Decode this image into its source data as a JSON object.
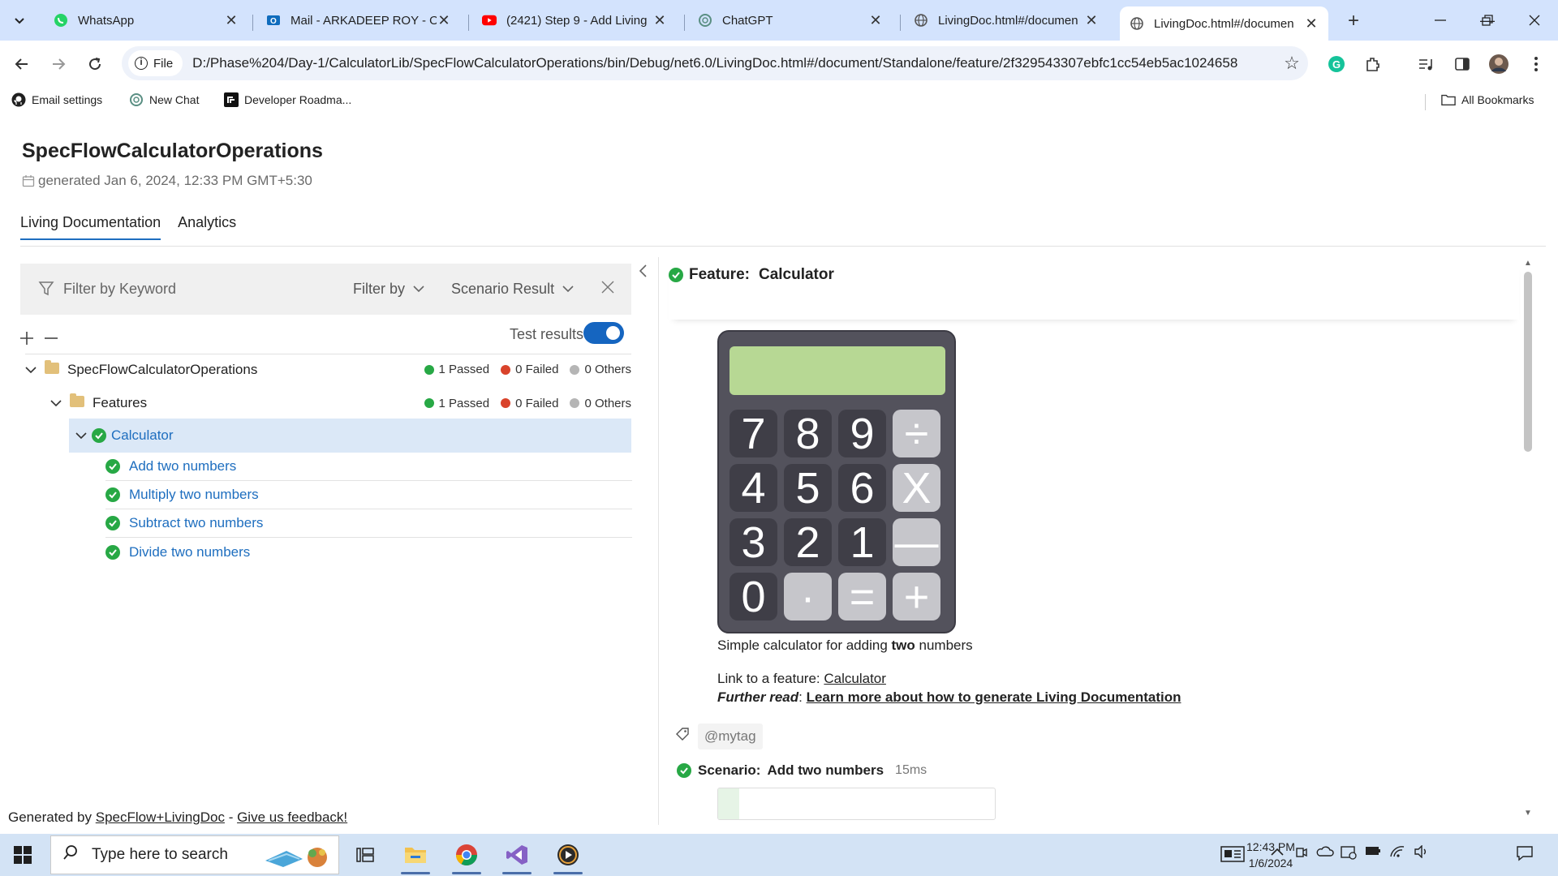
{
  "browser": {
    "tabs": [
      {
        "title": "WhatsApp",
        "icon": "whatsapp-icon"
      },
      {
        "title": "Mail - ARKADEEP ROY - Ou",
        "icon": "outlook-icon"
      },
      {
        "title": "(2421) Step 9 - Add Living",
        "icon": "youtube-icon"
      },
      {
        "title": "ChatGPT",
        "icon": "chatgpt-icon"
      },
      {
        "title": "LivingDoc.html#/documen",
        "icon": "globe-icon"
      },
      {
        "title": "LivingDoc.html#/documen",
        "icon": "globe-icon",
        "active": true
      }
    ],
    "address": {
      "scheme_label": "File",
      "url": "D:/Phase%204/Day-1/CalculatorLib/SpecFlowCalculatorOperations/bin/Debug/net6.0/LivingDoc.html#/document/Standalone/feature/2f329543307ebfc1cc54eb5ac1024658"
    },
    "bookmarks": [
      {
        "label": "Email settings",
        "icon": "github-icon"
      },
      {
        "label": "New Chat",
        "icon": "chatgpt-icon"
      },
      {
        "label": "Developer Roadma...",
        "icon": "roadmap-icon"
      }
    ],
    "all_bookmarks_label": "All Bookmarks"
  },
  "page": {
    "title": "SpecFlowCalculatorOperations",
    "generated": "generated Jan 6, 2024, 12:33 PM GMT+5:30",
    "tabs": [
      "Living Documentation",
      "Analytics"
    ],
    "filter": {
      "keyword_placeholder": "Filter by Keyword",
      "filter_by_label": "Filter by",
      "scenario_result_label": "Scenario Result"
    },
    "test_results_label": "Test results",
    "tree": {
      "root": {
        "label": "SpecFlowCalculatorOperations",
        "passed": "1 Passed",
        "failed": "0 Failed",
        "others": "0 Others"
      },
      "features": {
        "label": "Features",
        "passed": "1 Passed",
        "failed": "0 Failed",
        "others": "0 Others"
      },
      "feature": {
        "label": "Calculator"
      },
      "scenarios": [
        "Add two numbers",
        "Multiply two numbers",
        "Subtract two numbers",
        "Divide two numbers"
      ]
    },
    "detail": {
      "feature_prefix": "Feature:",
      "feature_name": "Calculator",
      "calculator_keys": [
        "7",
        "8",
        "9",
        "÷",
        "4",
        "5",
        "6",
        "X",
        "3",
        "2",
        "1",
        "—",
        "0",
        "·",
        "=",
        "+"
      ],
      "description_pre": "Simple calculator for adding ",
      "description_bold": "two",
      "description_post": " numbers",
      "link_pre": "Link to a feature: ",
      "link_text": "Calculator",
      "further_label": "Further read",
      "further_sep": ": ",
      "further_link": "Learn more about how to generate Living Documentation",
      "tag": "@mytag",
      "scenario_prefix": "Scenario:",
      "scenario_name": "Add two numbers",
      "scenario_duration": "15ms"
    },
    "footer": {
      "pre": "Generated by ",
      "link1": "SpecFlow+LivingDoc",
      "sep": " - ",
      "link2": "Give us feedback!"
    }
  },
  "taskbar": {
    "search_placeholder": "Type here to search",
    "time": "12:43 PM",
    "date": "1/6/2024"
  },
  "colors": {
    "passed": "#27a845",
    "failed": "#d9432b",
    "others": "#b5b5b5",
    "accent": "#1e6ebf",
    "tabstrip": "#d3e3fd"
  }
}
